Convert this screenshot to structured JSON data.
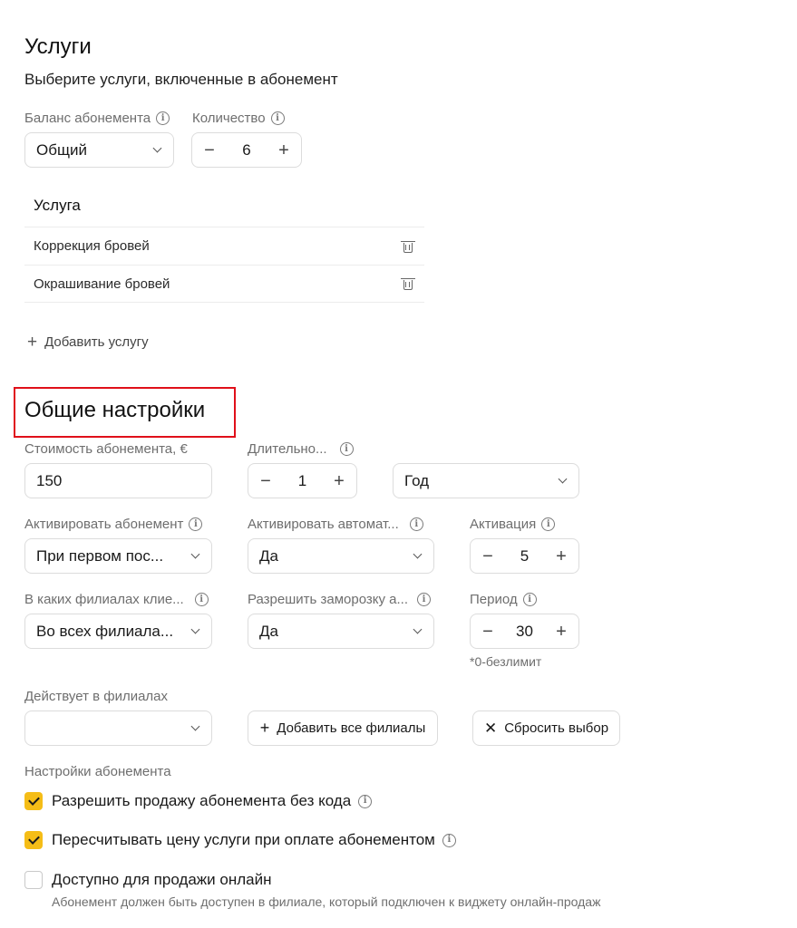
{
  "services": {
    "title": "Услуги",
    "subtitle": "Выберите услуги, включенные в абонемент",
    "balance": {
      "label": "Баланс абонемента",
      "value": "Общий"
    },
    "quantity": {
      "label": "Количество",
      "value": "6",
      "minus": "−",
      "plus": "+"
    },
    "table_header": "Услуга",
    "rows": [
      {
        "name": "Коррекция бровей"
      },
      {
        "name": "Окрашивание бровей"
      }
    ],
    "add_service": "Добавить услугу"
  },
  "general": {
    "title": "Общие настройки",
    "price": {
      "label": "Стоимость абонемента, €",
      "value": "150"
    },
    "duration": {
      "label": "Длительно...",
      "value": "1",
      "minus": "−",
      "plus": "+"
    },
    "duration_unit": {
      "value": "Год"
    },
    "activate": {
      "label": "Активировать абонемент",
      "value": "При первом пос..."
    },
    "auto_activate": {
      "label": "Активировать автомат...",
      "value": "Да"
    },
    "activation": {
      "label": "Активация",
      "value": "5",
      "minus": "−",
      "plus": "+"
    },
    "branches_clients": {
      "label": "В каких филиалах клие...",
      "value": "Во всех филиала..."
    },
    "freeze": {
      "label": "Разрешить заморозку а...",
      "value": "Да"
    },
    "period": {
      "label": "Период",
      "value": "30",
      "minus": "−",
      "plus": "+",
      "hint": "*0-безлимит"
    },
    "active_in": {
      "label": "Действует в филиалах",
      "value": ""
    },
    "add_all_branches": "Добавить все филиалы",
    "reset_selection": "Сбросить выбор",
    "settings_label": "Настройки абонемента",
    "options": [
      {
        "label": "Разрешить продажу абонемента без кода",
        "checked": true
      },
      {
        "label": "Пересчитывать цену услуги при оплате абонементом",
        "checked": true
      },
      {
        "label": "Доступно для продажи онлайн",
        "checked": false,
        "hint": "Абонемент должен быть доступен в филиале, который подключен к виджету онлайн-продаж"
      }
    ]
  },
  "colors": {
    "accent_checkbox": "#f5bd17",
    "highlight_border": "#e0101a"
  }
}
